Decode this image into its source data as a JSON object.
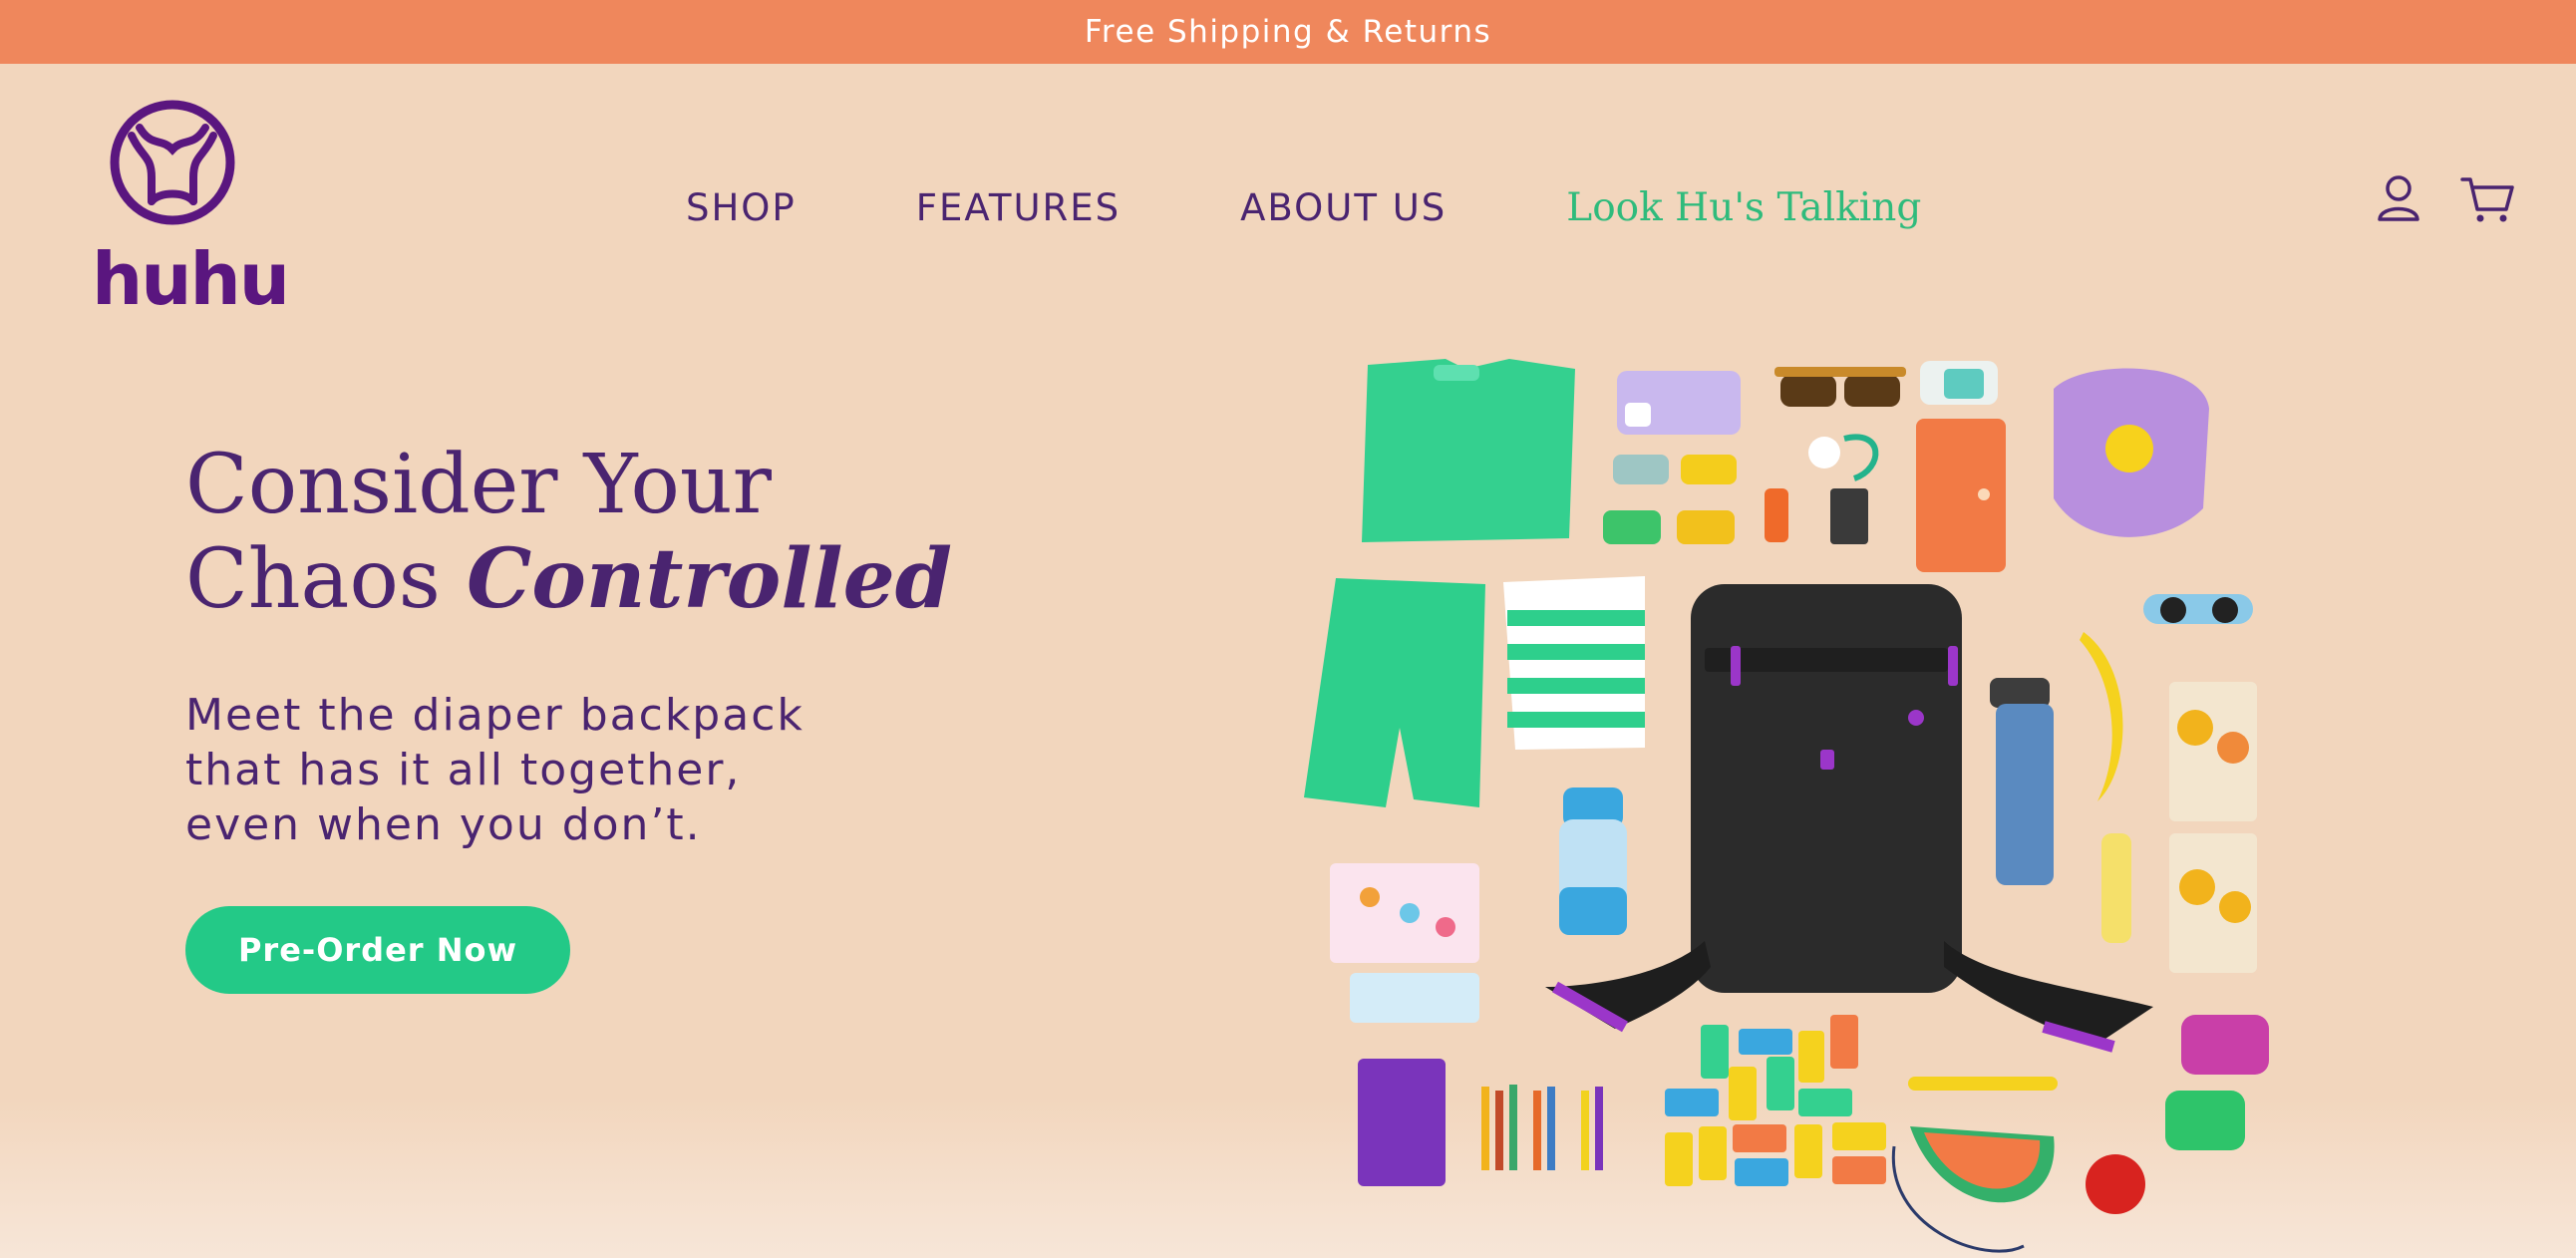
{
  "announcement": {
    "text": "Free Shipping & Returns"
  },
  "brand": {
    "name": "huhu",
    "logo_icon": "huhu-lion-icon",
    "color": "#5a167f"
  },
  "nav": {
    "items": [
      {
        "label": "SHOP"
      },
      {
        "label": "FEATURES"
      },
      {
        "label": "ABOUT US"
      },
      {
        "label": "Look Hu's Talking",
        "color": "#2fbb7c"
      }
    ]
  },
  "header_icons": [
    "account-icon",
    "cart-icon"
  ],
  "hero": {
    "title_line1": "Consider Your",
    "title_line2_plain": "Chaos",
    "title_line2_emphasis": "Controlled",
    "subtitle_lines": [
      "Meet the diaper backpack",
      "that has it all together,",
      "even when you don’t."
    ],
    "cta_label": "Pre-Order Now",
    "cta_color": "#23c987"
  },
  "colors": {
    "background": "#f2d6bd",
    "announcement_bg": "#ef875c",
    "text": "#4a2470"
  }
}
